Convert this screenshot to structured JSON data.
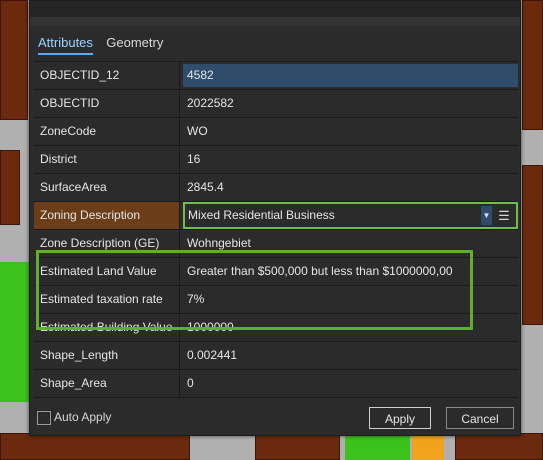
{
  "tabs": [
    {
      "label": "Attributes",
      "active": true
    },
    {
      "label": "Geometry",
      "active": false
    }
  ],
  "rows": [
    {
      "label": "OBJECTID_12",
      "value": "4582"
    },
    {
      "label": "OBJECTID",
      "value": "2022582"
    },
    {
      "label": "ZoneCode",
      "value": "WO"
    },
    {
      "label": "District",
      "value": "16"
    },
    {
      "label": "SurfaceArea",
      "value": "2845.4"
    },
    {
      "label": "Zoning Description",
      "value": "Mixed Residential Business"
    },
    {
      "label": "Zone Description (GE)",
      "value": "Wohngebiet"
    },
    {
      "label": "Estimated Land Value",
      "value": "Greater than $500,000 but less than $1000000,00"
    },
    {
      "label": "Estimated taxation rate",
      "value": "7%"
    },
    {
      "label": "Estimated Building Value",
      "value": "1000000"
    },
    {
      "label": "Shape_Length",
      "value": "0.002441"
    },
    {
      "label": "Shape_Area",
      "value": "0"
    }
  ],
  "footer": {
    "auto_apply_label": "Auto Apply",
    "auto_apply_checked": false,
    "apply_label": "Apply",
    "cancel_label": "Cancel"
  },
  "icons": {
    "dropdown": "chevron-down-icon",
    "domain_editor": "list-edit-icon"
  },
  "colors": {
    "highlight_border": "#5faf2f",
    "selected_value_bg": "#2f4d6b",
    "highlight_label_bg": "#6b3d18",
    "tab_accent": "#5aa9ff"
  }
}
